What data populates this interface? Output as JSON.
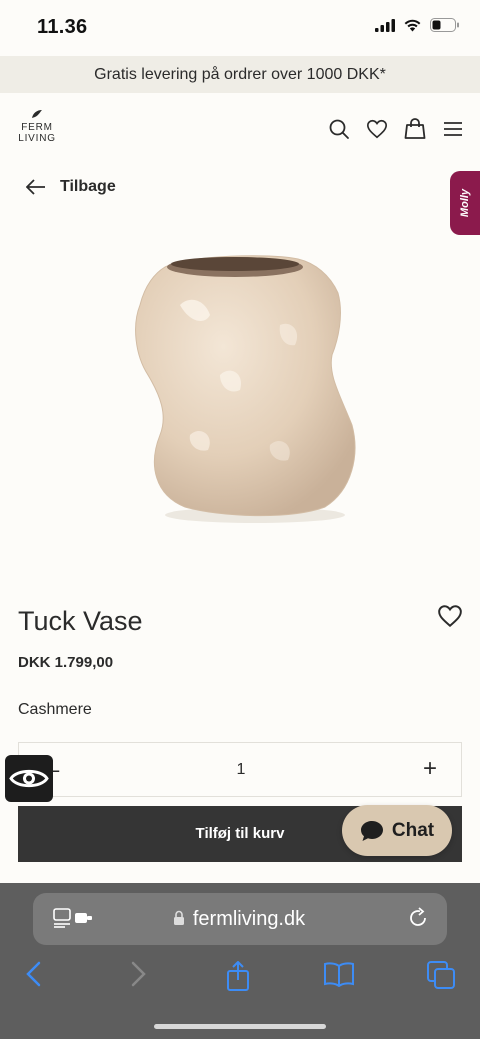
{
  "status_bar": {
    "time": "11.36"
  },
  "promo": {
    "text": "Gratis levering på ordrer over 1000 DKK*"
  },
  "header": {
    "logo_line1": "FERM",
    "logo_line2": "LIVING",
    "icons": [
      "search-icon",
      "heart-icon",
      "shopping-bag-icon",
      "menu-icon"
    ]
  },
  "nav": {
    "back_label": "Tilbage"
  },
  "molly": {
    "label": "Molly",
    "color": "#8b1a4c"
  },
  "product": {
    "title": "Tuck Vase",
    "price": "DKK 1.799,00",
    "variant": "Cashmere",
    "quantity": "1",
    "minus_label": "–",
    "plus_label": "+",
    "add_to_cart_label": "Tilføj til kurv"
  },
  "chat": {
    "label": "Chat",
    "color": "#d9c8b0"
  },
  "browser": {
    "url": "fermliving.dk",
    "toolbar_icons": [
      "back-icon",
      "forward-icon",
      "share-icon",
      "bookmarks-icon",
      "tabs-icon"
    ]
  },
  "colors": {
    "accent_dark": "#353535",
    "banner_bg": "#efede6",
    "ios_blue": "#3d8cf5"
  }
}
